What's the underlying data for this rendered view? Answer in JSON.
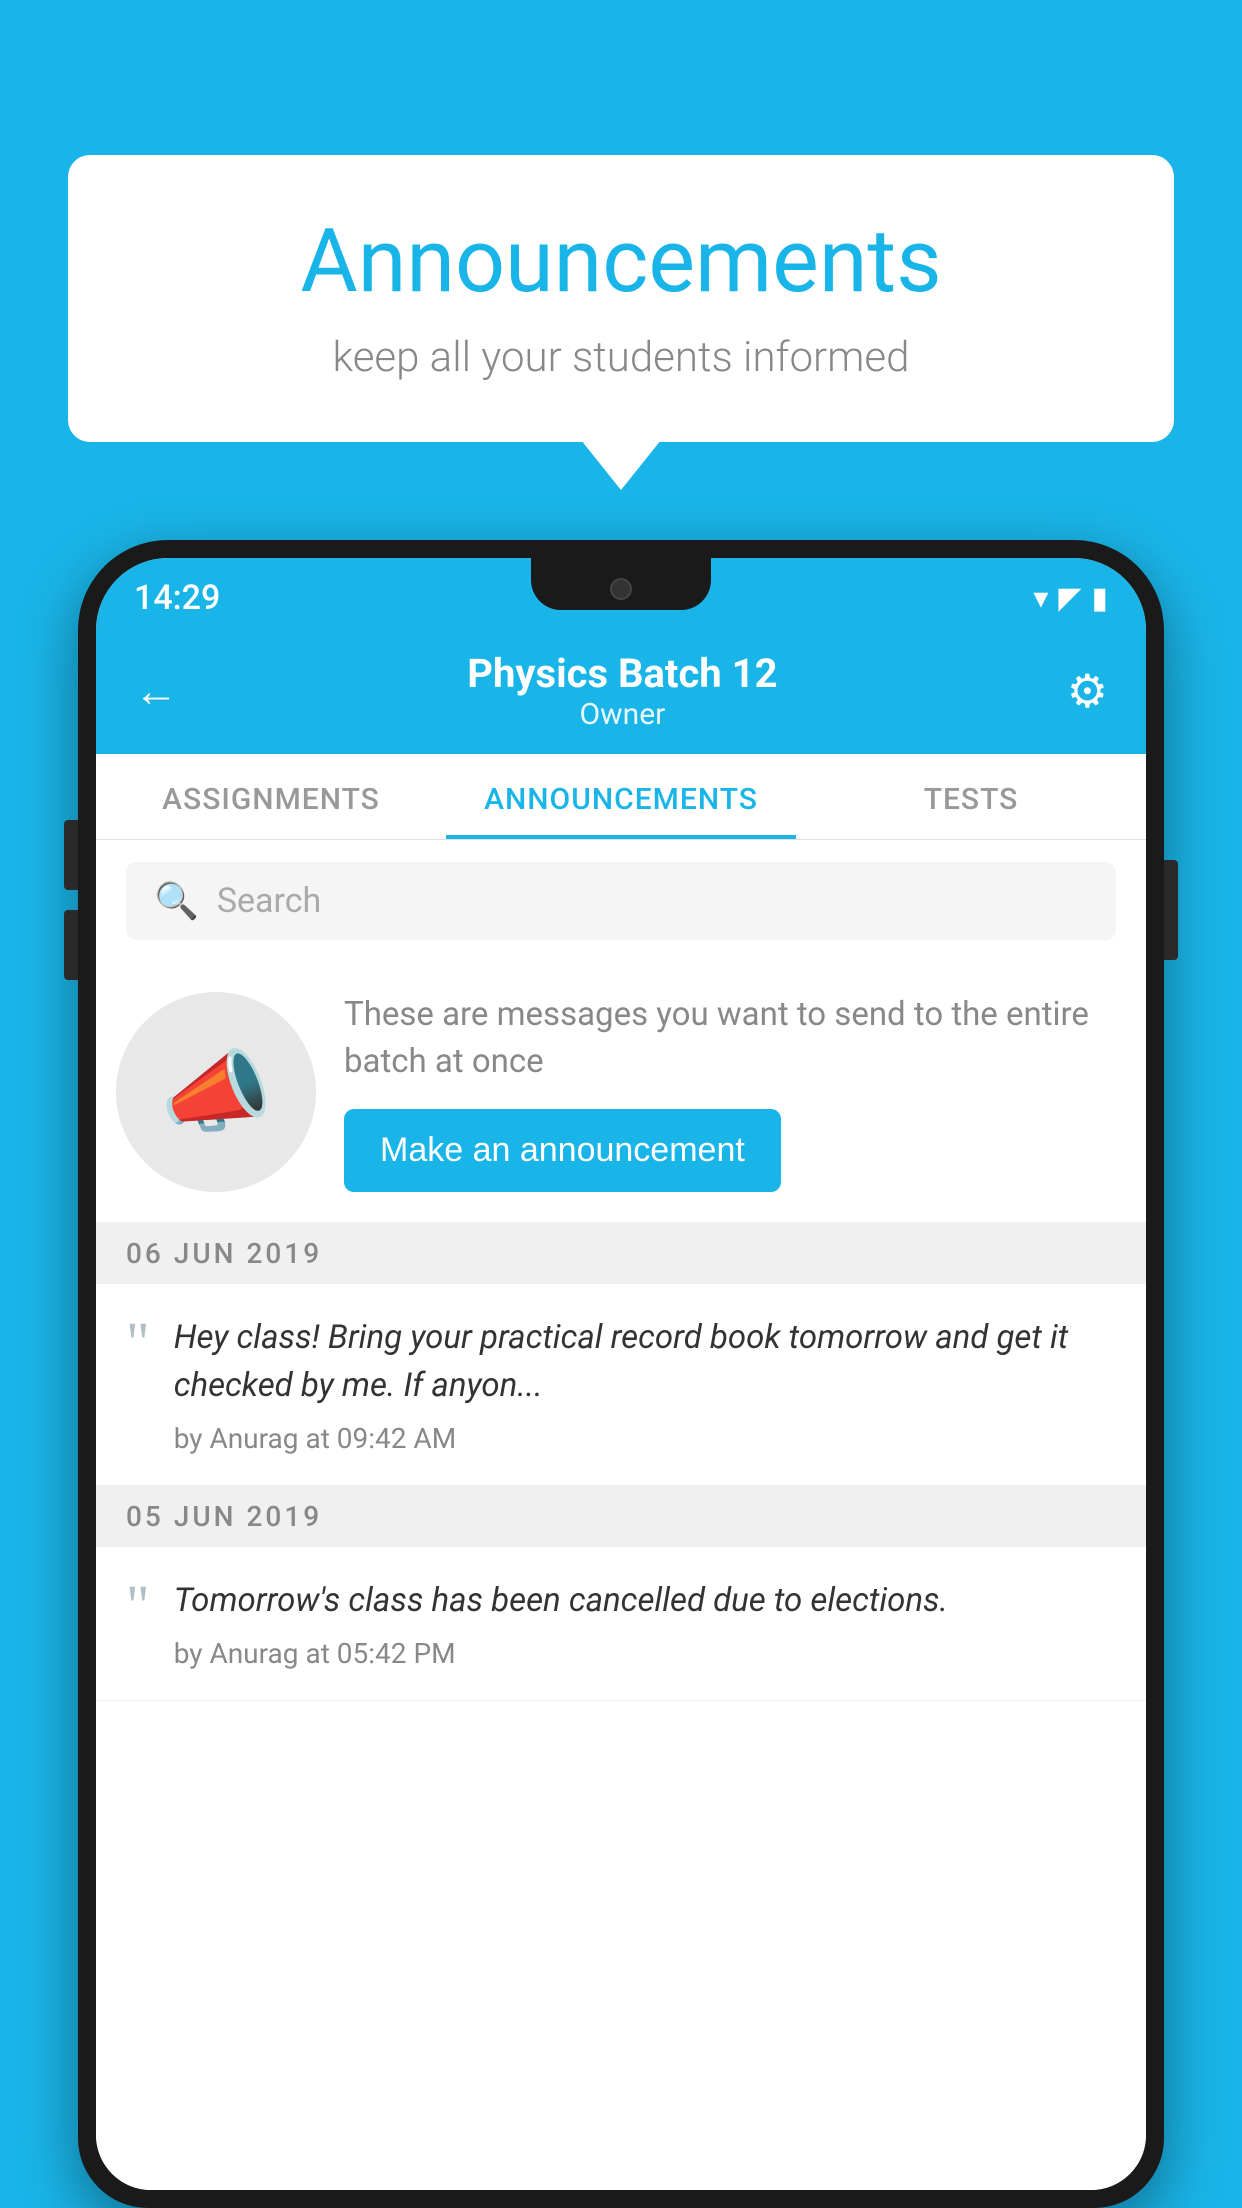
{
  "background_color": "#1ab5e8",
  "speech_bubble": {
    "title": "Announcements",
    "subtitle": "keep all your students informed"
  },
  "phone": {
    "status_bar": {
      "time": "14:29",
      "wifi": "▾",
      "signal": "▲",
      "battery": "▮"
    },
    "header": {
      "title": "Physics Batch 12",
      "subtitle": "Owner",
      "back_label": "←",
      "gear_label": "⚙"
    },
    "tabs": [
      {
        "label": "ASSIGNMENTS",
        "active": false
      },
      {
        "label": "ANNOUNCEMENTS",
        "active": true
      },
      {
        "label": "TESTS",
        "active": false
      }
    ],
    "search": {
      "placeholder": "Search"
    },
    "promo": {
      "description": "These are messages you want to send to the entire batch at once",
      "button_label": "Make an announcement"
    },
    "announcements": [
      {
        "date": "06  JUN  2019",
        "text": "Hey class! Bring your practical record book tomorrow and get it checked by me. If anyon...",
        "meta": "by Anurag at 09:42 AM"
      },
      {
        "date": "05  JUN  2019",
        "text": "Tomorrow's class has been cancelled due to elections.",
        "meta": "by Anurag at 05:42 PM"
      }
    ]
  }
}
